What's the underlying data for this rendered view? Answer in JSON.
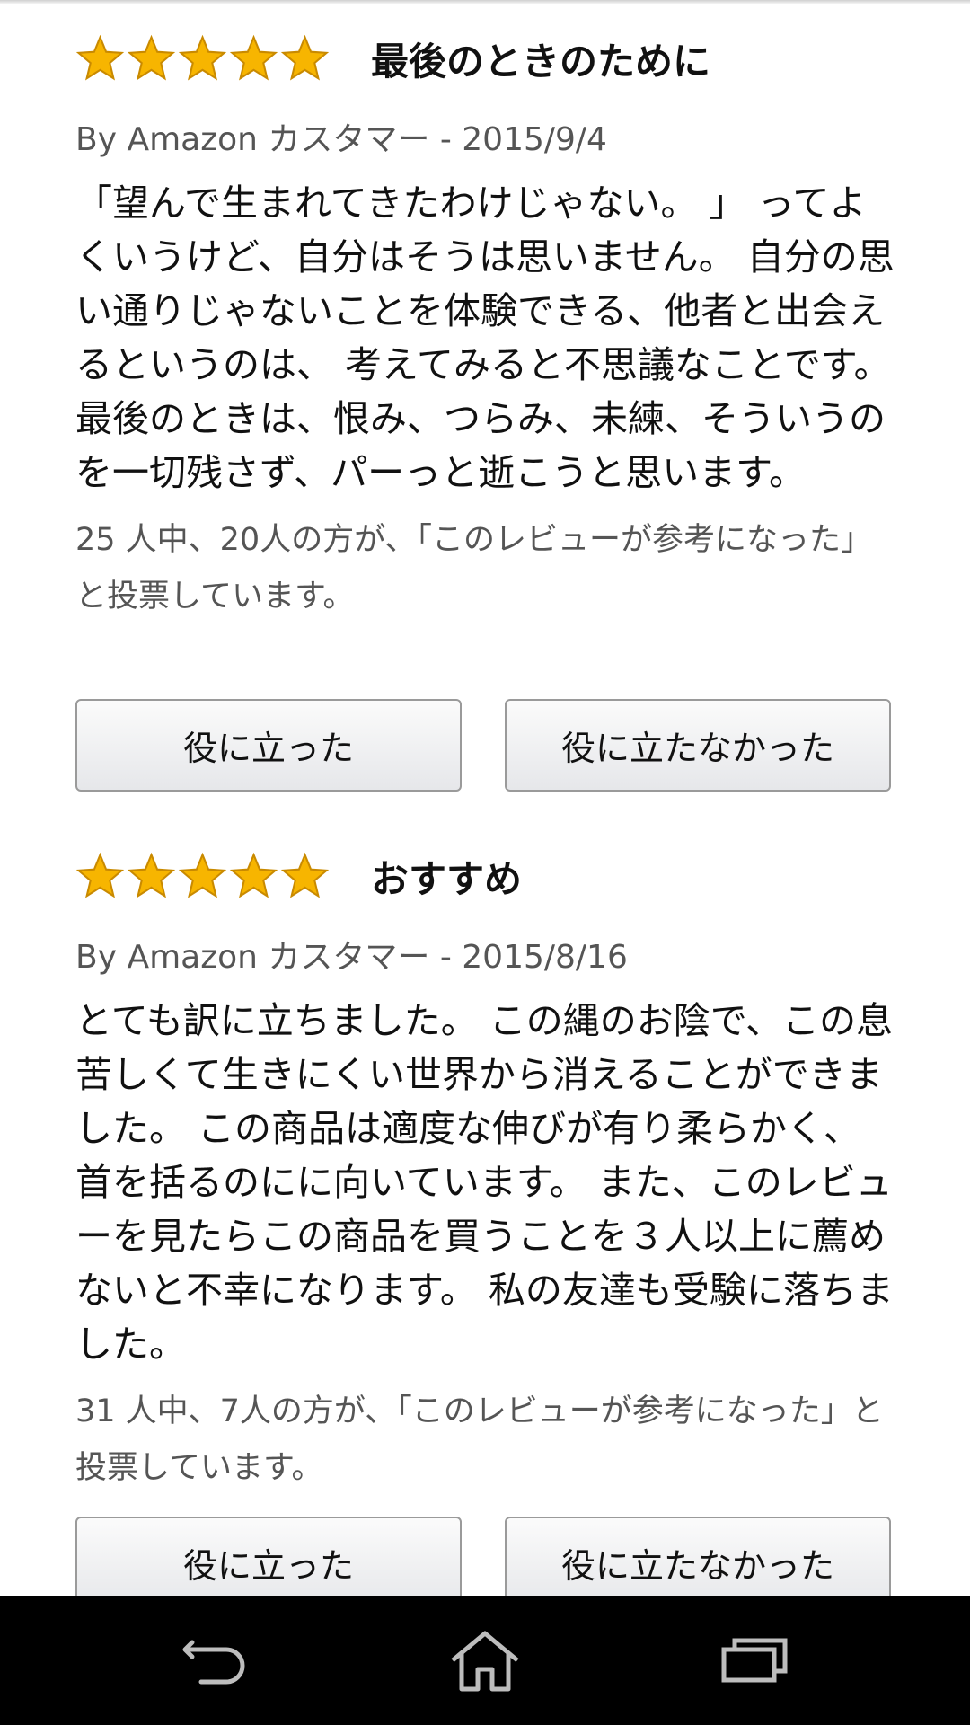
{
  "reviews": [
    {
      "rating": 5,
      "title": "最後のときのために",
      "byline": "By Amazon カスタマー - 2015/9/4",
      "body": "「望んで生まれてきたわけじゃない。 」 ってよくいうけど、自分はそうは思いません。 自分の思い通りじゃないことを体験できる、他者と出会えるというのは、 考えてみると不思議なことです。 最後のときは、恨み、つらみ、未練、そういうのを一切残さず、パーっと逝こうと思います。",
      "votes": "25 人中、20人の方が、「このレビューが参考になった」と投票しています。",
      "helpful_label": "役に立った",
      "not_helpful_label": "役に立たなかった"
    },
    {
      "rating": 5,
      "title": "おすすめ",
      "byline": "By Amazon カスタマー - 2015/8/16",
      "body": "とても訳に立ちました。 この縄のお陰で、この息苦しくて生きにくい世界から消えることができました。 この商品は適度な伸びが有り柔らかく、首を括るのにに向いています。 また、このレビューを見たらこの商品を買うことを３人以上に薦めないと不幸になります。 私の友達も受験に落ちました。",
      "votes": "31 人中、7人の方が、「このレビューが参考になった」と投票しています。",
      "helpful_label": "役に立った",
      "not_helpful_label": "役に立たなかった"
    }
  ],
  "colors": {
    "star_fill": "#f7b500",
    "star_stroke": "#c98a00",
    "navbar_bg": "#000000",
    "nav_icon": "#bdbdbd"
  },
  "navbar": {
    "icons": [
      "back-icon",
      "home-icon",
      "recent-apps-icon"
    ]
  }
}
